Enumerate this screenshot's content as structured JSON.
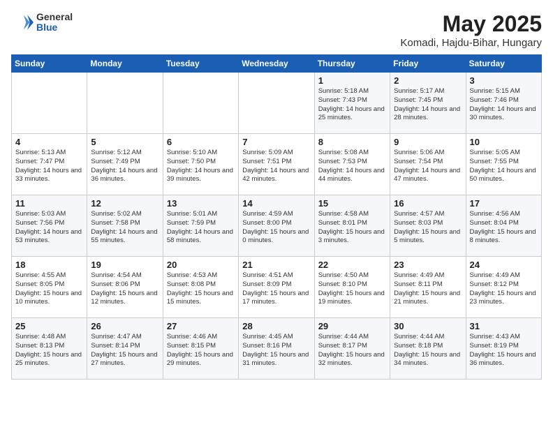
{
  "header": {
    "logo_general": "General",
    "logo_blue": "Blue",
    "title": "May 2025",
    "subtitle": "Komadi, Hajdu-Bihar, Hungary"
  },
  "weekdays": [
    "Sunday",
    "Monday",
    "Tuesday",
    "Wednesday",
    "Thursday",
    "Friday",
    "Saturday"
  ],
  "weeks": [
    [
      {
        "day": "",
        "content": ""
      },
      {
        "day": "",
        "content": ""
      },
      {
        "day": "",
        "content": ""
      },
      {
        "day": "",
        "content": ""
      },
      {
        "day": "1",
        "content": "Sunrise: 5:18 AM\nSunset: 7:43 PM\nDaylight: 14 hours\nand 25 minutes."
      },
      {
        "day": "2",
        "content": "Sunrise: 5:17 AM\nSunset: 7:45 PM\nDaylight: 14 hours\nand 28 minutes."
      },
      {
        "day": "3",
        "content": "Sunrise: 5:15 AM\nSunset: 7:46 PM\nDaylight: 14 hours\nand 30 minutes."
      }
    ],
    [
      {
        "day": "4",
        "content": "Sunrise: 5:13 AM\nSunset: 7:47 PM\nDaylight: 14 hours\nand 33 minutes."
      },
      {
        "day": "5",
        "content": "Sunrise: 5:12 AM\nSunset: 7:49 PM\nDaylight: 14 hours\nand 36 minutes."
      },
      {
        "day": "6",
        "content": "Sunrise: 5:10 AM\nSunset: 7:50 PM\nDaylight: 14 hours\nand 39 minutes."
      },
      {
        "day": "7",
        "content": "Sunrise: 5:09 AM\nSunset: 7:51 PM\nDaylight: 14 hours\nand 42 minutes."
      },
      {
        "day": "8",
        "content": "Sunrise: 5:08 AM\nSunset: 7:53 PM\nDaylight: 14 hours\nand 44 minutes."
      },
      {
        "day": "9",
        "content": "Sunrise: 5:06 AM\nSunset: 7:54 PM\nDaylight: 14 hours\nand 47 minutes."
      },
      {
        "day": "10",
        "content": "Sunrise: 5:05 AM\nSunset: 7:55 PM\nDaylight: 14 hours\nand 50 minutes."
      }
    ],
    [
      {
        "day": "11",
        "content": "Sunrise: 5:03 AM\nSunset: 7:56 PM\nDaylight: 14 hours\nand 53 minutes."
      },
      {
        "day": "12",
        "content": "Sunrise: 5:02 AM\nSunset: 7:58 PM\nDaylight: 14 hours\nand 55 minutes."
      },
      {
        "day": "13",
        "content": "Sunrise: 5:01 AM\nSunset: 7:59 PM\nDaylight: 14 hours\nand 58 minutes."
      },
      {
        "day": "14",
        "content": "Sunrise: 4:59 AM\nSunset: 8:00 PM\nDaylight: 15 hours\nand 0 minutes."
      },
      {
        "day": "15",
        "content": "Sunrise: 4:58 AM\nSunset: 8:01 PM\nDaylight: 15 hours\nand 3 minutes."
      },
      {
        "day": "16",
        "content": "Sunrise: 4:57 AM\nSunset: 8:03 PM\nDaylight: 15 hours\nand 5 minutes."
      },
      {
        "day": "17",
        "content": "Sunrise: 4:56 AM\nSunset: 8:04 PM\nDaylight: 15 hours\nand 8 minutes."
      }
    ],
    [
      {
        "day": "18",
        "content": "Sunrise: 4:55 AM\nSunset: 8:05 PM\nDaylight: 15 hours\nand 10 minutes."
      },
      {
        "day": "19",
        "content": "Sunrise: 4:54 AM\nSunset: 8:06 PM\nDaylight: 15 hours\nand 12 minutes."
      },
      {
        "day": "20",
        "content": "Sunrise: 4:53 AM\nSunset: 8:08 PM\nDaylight: 15 hours\nand 15 minutes."
      },
      {
        "day": "21",
        "content": "Sunrise: 4:51 AM\nSunset: 8:09 PM\nDaylight: 15 hours\nand 17 minutes."
      },
      {
        "day": "22",
        "content": "Sunrise: 4:50 AM\nSunset: 8:10 PM\nDaylight: 15 hours\nand 19 minutes."
      },
      {
        "day": "23",
        "content": "Sunrise: 4:49 AM\nSunset: 8:11 PM\nDaylight: 15 hours\nand 21 minutes."
      },
      {
        "day": "24",
        "content": "Sunrise: 4:49 AM\nSunset: 8:12 PM\nDaylight: 15 hours\nand 23 minutes."
      }
    ],
    [
      {
        "day": "25",
        "content": "Sunrise: 4:48 AM\nSunset: 8:13 PM\nDaylight: 15 hours\nand 25 minutes."
      },
      {
        "day": "26",
        "content": "Sunrise: 4:47 AM\nSunset: 8:14 PM\nDaylight: 15 hours\nand 27 minutes."
      },
      {
        "day": "27",
        "content": "Sunrise: 4:46 AM\nSunset: 8:15 PM\nDaylight: 15 hours\nand 29 minutes."
      },
      {
        "day": "28",
        "content": "Sunrise: 4:45 AM\nSunset: 8:16 PM\nDaylight: 15 hours\nand 31 minutes."
      },
      {
        "day": "29",
        "content": "Sunrise: 4:44 AM\nSunset: 8:17 PM\nDaylight: 15 hours\nand 32 minutes."
      },
      {
        "day": "30",
        "content": "Sunrise: 4:44 AM\nSunset: 8:18 PM\nDaylight: 15 hours\nand 34 minutes."
      },
      {
        "day": "31",
        "content": "Sunrise: 4:43 AM\nSunset: 8:19 PM\nDaylight: 15 hours\nand 36 minutes."
      }
    ]
  ]
}
